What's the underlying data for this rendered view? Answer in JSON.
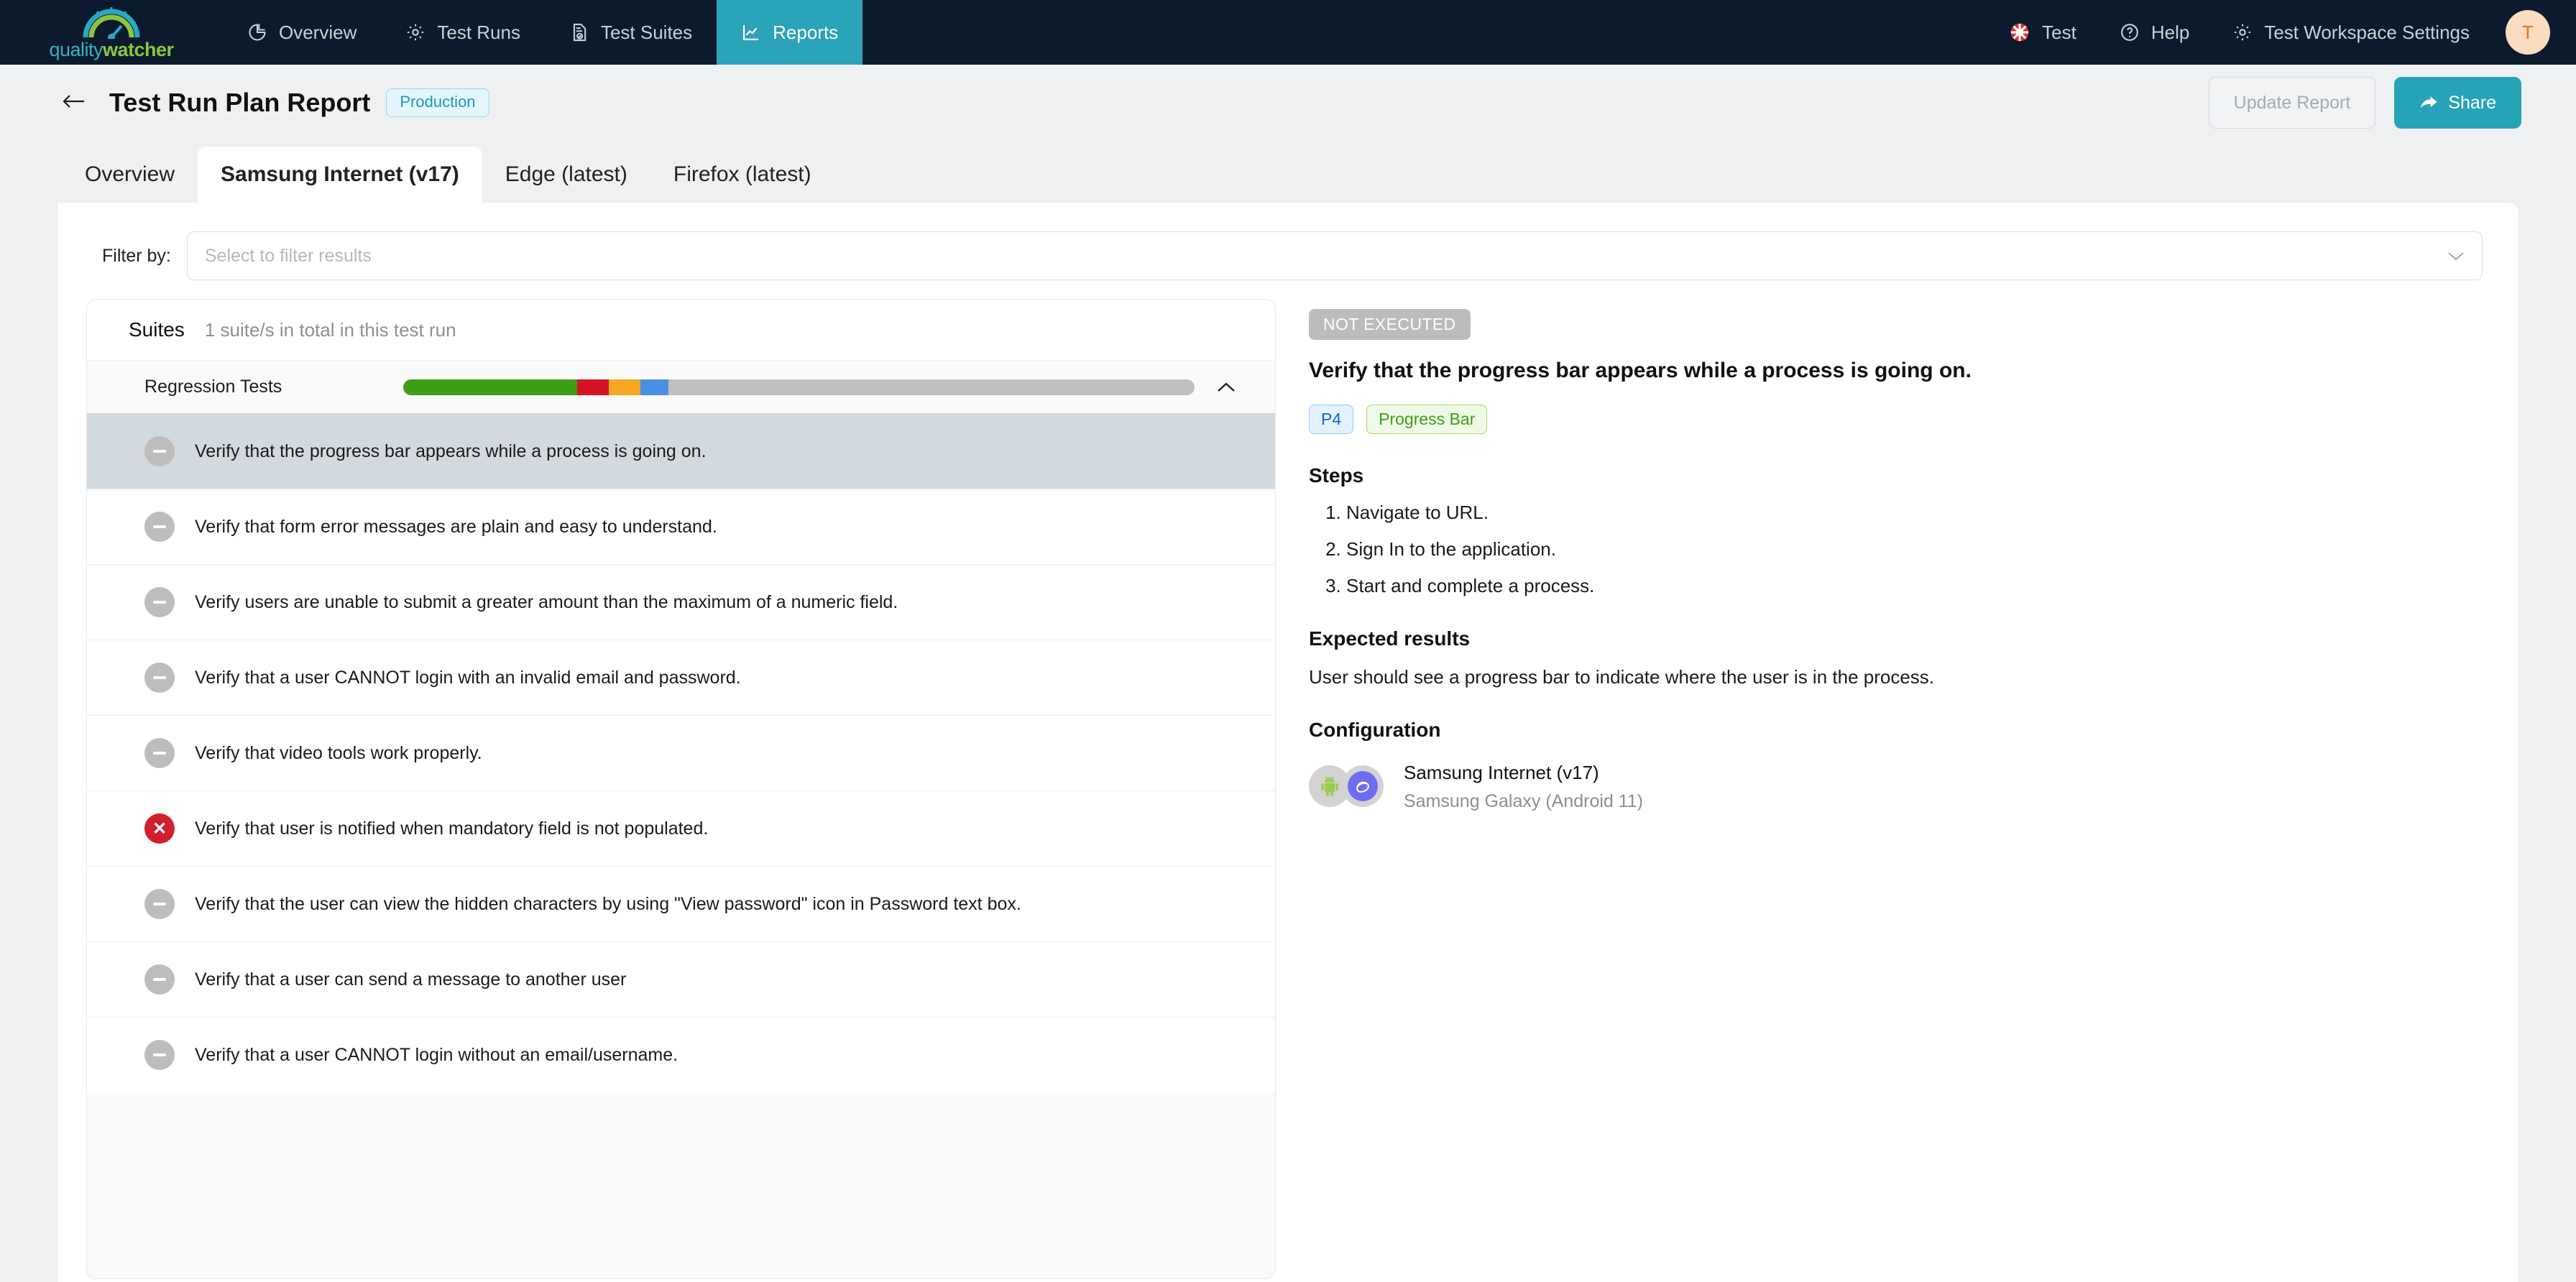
{
  "brand": {
    "part1": "quality",
    "part2": "watcher"
  },
  "topnav": {
    "items": [
      {
        "label": "Overview",
        "icon": "pie-chart-icon",
        "active": false
      },
      {
        "label": "Test Runs",
        "icon": "gear-icon",
        "active": false
      },
      {
        "label": "Test Suites",
        "icon": "document-check-icon",
        "active": false
      },
      {
        "label": "Reports",
        "icon": "line-chart-icon",
        "active": true
      }
    ],
    "right": [
      {
        "label": "Test",
        "icon": "workspace-icon"
      },
      {
        "label": "Help",
        "icon": "question-circle-icon"
      },
      {
        "label": "Test Workspace Settings",
        "icon": "gear-icon"
      }
    ],
    "avatar_initial": "T"
  },
  "header": {
    "back_icon": "back-arrow-icon",
    "title": "Test Run Plan Report",
    "environment_badge": "Production",
    "update_button": "Update Report",
    "share_button": "Share"
  },
  "tabs": [
    {
      "label": "Overview",
      "active": false
    },
    {
      "label": "Samsung Internet (v17)",
      "active": true
    },
    {
      "label": "Edge (latest)",
      "active": false
    },
    {
      "label": "Firefox (latest)",
      "active": false
    }
  ],
  "filter": {
    "label": "Filter by:",
    "placeholder": "Select to filter results",
    "value": ""
  },
  "suites": {
    "title": "Suites",
    "subtitle": "1 suite/s in total in this test run",
    "suite_name": "Regression Tests",
    "progress": {
      "passed_pct": 22,
      "failed_pct": 4,
      "blocked_pct": 4,
      "retest_pct": 3.5,
      "not_executed_pct": 66.5,
      "colors": {
        "passed": "#3f9e18",
        "failed": "#d41426",
        "blocked": "#f5a623",
        "retest": "#4a90e2",
        "not_executed": "#bfbfbf"
      }
    },
    "tests": [
      {
        "status": "not-executed",
        "title": "Verify that the progress bar appears while a process is going on.",
        "selected": true
      },
      {
        "status": "not-executed",
        "title": "Verify that form error messages are plain and easy to understand.",
        "selected": false
      },
      {
        "status": "not-executed",
        "title": "Verify users are unable to submit a greater amount than the maximum of a numeric field.",
        "selected": false
      },
      {
        "status": "not-executed",
        "title": "Verify that a user CANNOT login with an invalid email and password.",
        "selected": false
      },
      {
        "status": "not-executed",
        "title": "Verify that video tools work properly.",
        "selected": false
      },
      {
        "status": "failed",
        "title": "Verify that user is notified when mandatory field is not populated.",
        "selected": false
      },
      {
        "status": "not-executed",
        "title": "Verify that the user can view the hidden characters by using \"View password\" icon in Password text box.",
        "selected": false
      },
      {
        "status": "not-executed",
        "title": "Verify that a user can send a message to another user",
        "selected": false
      },
      {
        "status": "not-executed",
        "title": "Verify that a user CANNOT login without an email/username.",
        "selected": false
      }
    ]
  },
  "detail": {
    "status_badge": "NOT EXECUTED",
    "title": "Verify that the progress bar appears while a process is going on.",
    "priority_tag": "P4",
    "feature_tag": "Progress Bar",
    "steps_heading": "Steps",
    "steps": [
      "Navigate to URL.",
      "Sign In to the application.",
      "Start and complete a process."
    ],
    "expected_heading": "Expected results",
    "expected_text": "User should see a progress bar to indicate where the user is in the process.",
    "config_heading": "Configuration",
    "config_browser": "Samsung Internet (v17)",
    "config_device": "Samsung Galaxy (Android 11)",
    "config_os_icon": "android-icon",
    "config_browser_icon": "samsung-internet-icon"
  }
}
